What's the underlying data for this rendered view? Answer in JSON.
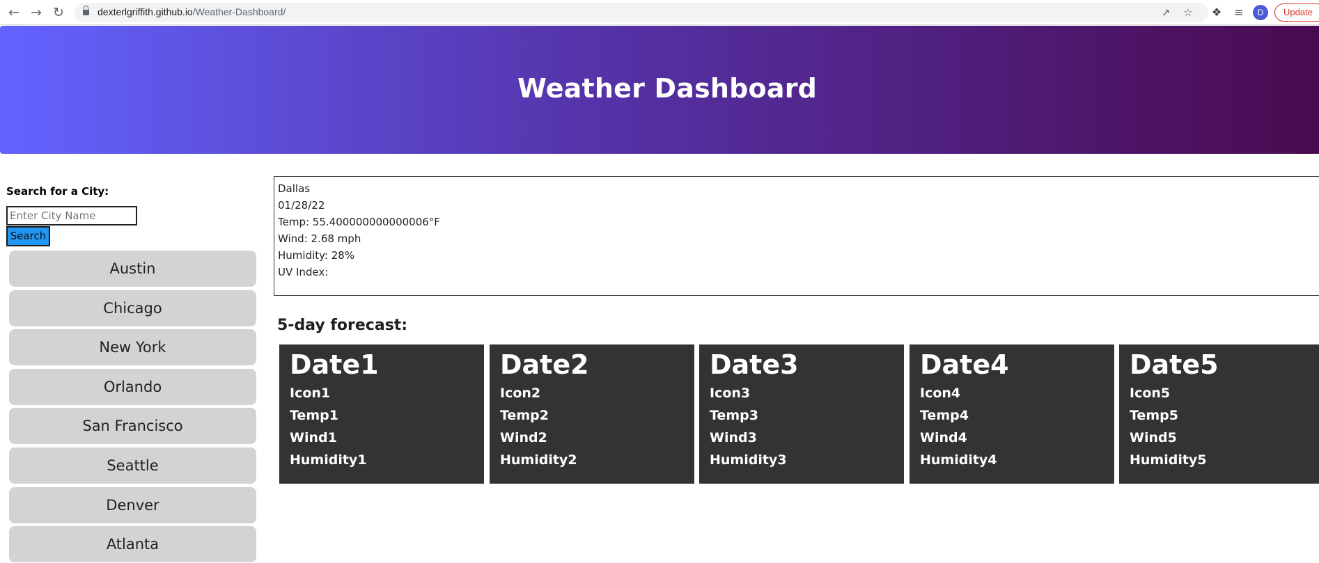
{
  "browser": {
    "url_host": "dexterlgriffith.github.io",
    "url_path": "/Weather-Dashboard/",
    "avatar_initial": "D",
    "update_label": "Update"
  },
  "header": {
    "title": "Weather Dashboard"
  },
  "sidebar": {
    "search_label": "Search for a City:",
    "search_placeholder": "Enter City Name",
    "search_value": "",
    "search_button": "Search",
    "cities": [
      "Austin",
      "Chicago",
      "New York",
      "Orlando",
      "San Francisco",
      "Seattle",
      "Denver",
      "Atlanta"
    ]
  },
  "current": {
    "city": "Dallas",
    "date": "01/28/22",
    "temp": "Temp: 55.400000000000006°F",
    "wind": "Wind: 2.68 mph",
    "humidity": "Humidity: 28%",
    "uv": "UV Index:"
  },
  "forecast": {
    "title": "5-day forecast:",
    "days": [
      {
        "date": "Date1",
        "icon": "Icon1",
        "temp": "Temp1",
        "wind": "Wind1",
        "humidity": "Humidity1"
      },
      {
        "date": "Date2",
        "icon": "Icon2",
        "temp": "Temp2",
        "wind": "Wind2",
        "humidity": "Humidity2"
      },
      {
        "date": "Date3",
        "icon": "Icon3",
        "temp": "Temp3",
        "wind": "Wind3",
        "humidity": "Humidity3"
      },
      {
        "date": "Date4",
        "icon": "Icon4",
        "temp": "Temp4",
        "wind": "Wind4",
        "humidity": "Humidity4"
      },
      {
        "date": "Date5",
        "icon": "Icon5",
        "temp": "Temp5",
        "wind": "Wind5",
        "humidity": "Humidity5"
      }
    ]
  },
  "colors": {
    "banner_start": "#6363ff",
    "banner_end": "#4a0a50",
    "search_button": "#2196f3",
    "city_button": "#d3d3d3",
    "forecast_card": "#333333"
  },
  "icons": [
    "back-arrow-icon",
    "forward-arrow-icon",
    "reload-icon",
    "lock-icon",
    "share-icon",
    "bookmark-star-icon",
    "extensions-puzzle-icon",
    "reading-list-icon"
  ]
}
